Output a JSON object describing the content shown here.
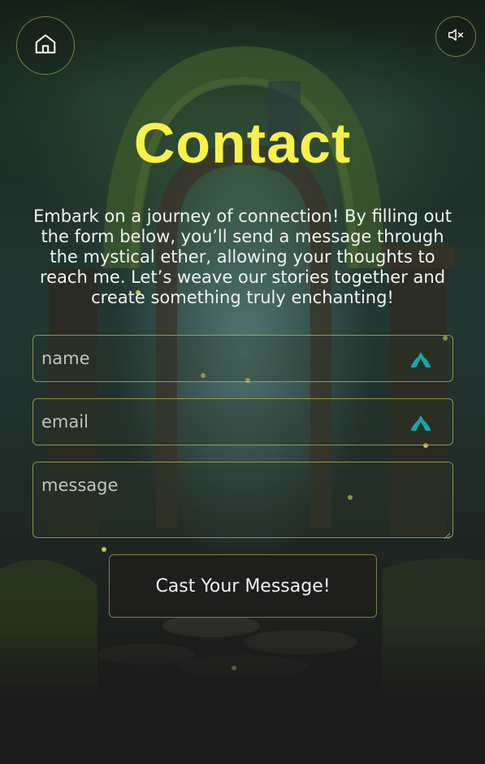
{
  "nav": {
    "home_icon": "home-icon",
    "mute_icon": "speaker-muted-icon"
  },
  "page": {
    "title": "Contact",
    "intro": "Embark on a journey of connection! By filling out the form below, you’ll send a message through the mystical ether, allowing your thoughts to reach me. Let’s weave our stories together and create something truly enchanting!"
  },
  "form": {
    "name_placeholder": "name",
    "email_placeholder": "email",
    "message_placeholder": "message",
    "submit_label": "Cast Your Message!",
    "autofill_icon": "password-manager-icon"
  },
  "colors": {
    "title": "#f7f24a",
    "border_accent": "#bebe5a",
    "autofill_icon": "#1aa6a6"
  }
}
